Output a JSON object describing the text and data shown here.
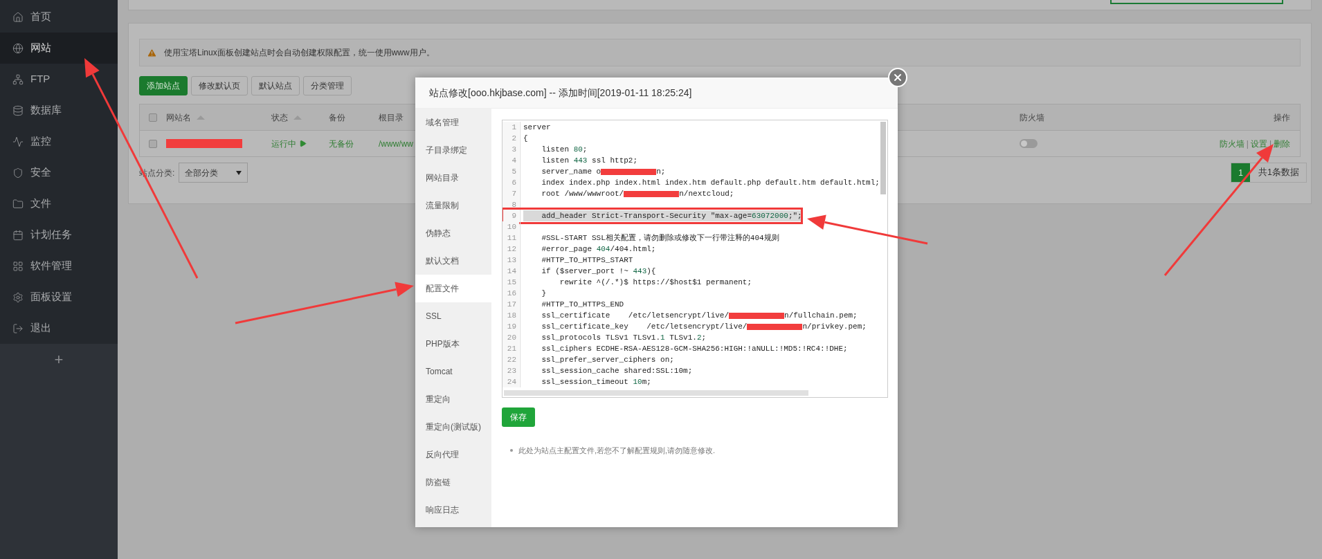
{
  "sidebar": {
    "items": [
      {
        "label": "首页",
        "selected": false
      },
      {
        "label": "网站",
        "selected": true
      },
      {
        "label": "FTP",
        "selected": false
      },
      {
        "label": "数据库",
        "selected": false
      },
      {
        "label": "监控",
        "selected": false
      },
      {
        "label": "安全",
        "selected": false
      },
      {
        "label": "文件",
        "selected": false
      },
      {
        "label": "计划任务",
        "selected": false
      },
      {
        "label": "软件管理",
        "selected": false
      },
      {
        "label": "面板设置",
        "selected": false
      },
      {
        "label": "退出",
        "selected": false
      }
    ],
    "add": "+"
  },
  "notice": "使用宝塔Linux面板创建站点时会自动创建权限配置，统一使用www用户。",
  "toolbar": [
    {
      "label": "添加站点",
      "kind": "primary"
    },
    {
      "label": "修改默认页",
      "kind": "default"
    },
    {
      "label": "默认站点",
      "kind": "default"
    },
    {
      "label": "分类管理",
      "kind": "default"
    }
  ],
  "table": {
    "all_checked": false,
    "columns": [
      {
        "label": "网站名",
        "sortable": true
      },
      {
        "label": "状态",
        "sortable": true
      },
      {
        "label": "备份",
        "sortable": false
      },
      {
        "label": "根目录",
        "sortable": false
      },
      {
        "label": "防火墙",
        "sortable": false
      },
      {
        "label": "操作",
        "sortable": false
      }
    ],
    "rows": [
      {
        "checked": false,
        "name_redacted": true,
        "status": "运行中",
        "backup": "无备份",
        "root": "/www/ww",
        "firewall_on": false,
        "actions": [
          "防火墙",
          "设置",
          "删除"
        ],
        "separator": "|"
      }
    ]
  },
  "category": {
    "label": "站点分类:",
    "value": "全部分类"
  },
  "pagination": {
    "pages": [
      {
        "label": "1",
        "selected": true
      }
    ],
    "total": "共1条数据"
  },
  "modal": {
    "title": "站点修改[ooo.hkjbase.com] -- 添加时间[2019-01-11 18:25:24]",
    "menu": [
      {
        "label": "域名管理",
        "selected": false
      },
      {
        "label": "子目录绑定",
        "selected": false
      },
      {
        "label": "网站目录",
        "selected": false
      },
      {
        "label": "流量限制",
        "selected": false
      },
      {
        "label": "伪静态",
        "selected": false
      },
      {
        "label": "默认文档",
        "selected": false
      },
      {
        "label": "配置文件",
        "selected": true
      },
      {
        "label": "SSL",
        "selected": false
      },
      {
        "label": "PHP版本",
        "selected": false
      },
      {
        "label": "Tomcat",
        "selected": false
      },
      {
        "label": "重定向",
        "selected": false
      },
      {
        "label": "重定向(测试版)",
        "selected": false
      },
      {
        "label": "反向代理",
        "selected": false
      },
      {
        "label": "防盗链",
        "selected": false
      },
      {
        "label": "响应日志",
        "selected": false
      }
    ],
    "code": [
      {
        "number": "1",
        "selected": false,
        "segments": [
          {
            "kind": "text",
            "text": "server"
          }
        ]
      },
      {
        "number": "2",
        "selected": false,
        "segments": [
          {
            "kind": "text",
            "text": "{"
          }
        ]
      },
      {
        "number": "3",
        "selected": false,
        "segments": [
          {
            "kind": "text",
            "text": "    listen "
          },
          {
            "kind": "num",
            "text": "80"
          },
          {
            "kind": "text",
            "text": ";"
          }
        ]
      },
      {
        "number": "4",
        "selected": false,
        "segments": [
          {
            "kind": "text",
            "text": "    listen "
          },
          {
            "kind": "num",
            "text": "443"
          },
          {
            "kind": "text",
            "text": " ssl http2;"
          }
        ]
      },
      {
        "number": "5",
        "selected": false,
        "segments": [
          {
            "kind": "text",
            "text": "    server_name o"
          },
          {
            "kind": "redacted"
          },
          {
            "kind": "text",
            "text": "n;"
          }
        ]
      },
      {
        "number": "6",
        "selected": false,
        "segments": [
          {
            "kind": "text",
            "text": "    index index.php index.html index.htm default.php default.htm default.html;"
          }
        ]
      },
      {
        "number": "7",
        "selected": false,
        "segments": [
          {
            "kind": "text",
            "text": "    root /www/wwwroot/"
          },
          {
            "kind": "redacted"
          },
          {
            "kind": "text",
            "text": "n/nextcloud;"
          }
        ]
      },
      {
        "number": "8",
        "selected": false
      },
      {
        "number": "9",
        "selected": true,
        "segments": [
          {
            "kind": "text",
            "text": "    add_header Strict-Transport-Security \"max-age="
          },
          {
            "kind": "num",
            "text": "63072000"
          },
          {
            "kind": "text",
            "text": ";\";"
          }
        ]
      },
      {
        "number": "10",
        "selected": false
      },
      {
        "number": "11",
        "selected": false,
        "segments": [
          {
            "kind": "text",
            "text": "    #SSL-START SSL相关配置，请勿删除或修改下一行带注释的404规则"
          }
        ]
      },
      {
        "number": "12",
        "selected": false,
        "segments": [
          {
            "kind": "text",
            "text": "    #error_page "
          },
          {
            "kind": "num",
            "text": "404"
          },
          {
            "kind": "text",
            "text": "/404.html;"
          }
        ]
      },
      {
        "number": "13",
        "selected": false,
        "segments": [
          {
            "kind": "text",
            "text": "    #HTTP_TO_HTTPS_START"
          }
        ]
      },
      {
        "number": "14",
        "selected": false,
        "segments": [
          {
            "kind": "text",
            "text": "    if ($server_port !~ "
          },
          {
            "kind": "num",
            "text": "443"
          },
          {
            "kind": "text",
            "text": "){"
          }
        ]
      },
      {
        "number": "15",
        "selected": false,
        "segments": [
          {
            "kind": "text",
            "text": "        rewrite ^(/.*)$ https://$host$1 permanent;"
          }
        ]
      },
      {
        "number": "16",
        "selected": false,
        "segments": [
          {
            "kind": "text",
            "text": "    }"
          }
        ]
      },
      {
        "number": "17",
        "selected": false,
        "segments": [
          {
            "kind": "text",
            "text": "    #HTTP_TO_HTTPS_END"
          }
        ]
      },
      {
        "number": "18",
        "selected": false,
        "segments": [
          {
            "kind": "text",
            "text": "    ssl_certificate    /etc/letsencrypt/live/"
          },
          {
            "kind": "redacted"
          },
          {
            "kind": "text",
            "text": "n/fullchain.pem;"
          }
        ]
      },
      {
        "number": "19",
        "selected": false,
        "segments": [
          {
            "kind": "text",
            "text": "    ssl_certificate_key    /etc/letsencrypt/live/"
          },
          {
            "kind": "redacted"
          },
          {
            "kind": "text",
            "text": "n/privkey.pem;"
          }
        ]
      },
      {
        "number": "20",
        "selected": false,
        "segments": [
          {
            "kind": "text",
            "text": "    ssl_protocols TLSv1 TLSv1."
          },
          {
            "kind": "num",
            "text": "1"
          },
          {
            "kind": "text",
            "text": " TLSv1."
          },
          {
            "kind": "num",
            "text": "2"
          },
          {
            "kind": "text",
            "text": ";"
          }
        ]
      },
      {
        "number": "21",
        "selected": false,
        "segments": [
          {
            "kind": "text",
            "text": "    ssl_ciphers ECDHE-RSA-AES128-GCM-SHA256:HIGH:!aNULL:!MD5:!RC4:!DHE;"
          }
        ]
      },
      {
        "number": "22",
        "selected": false,
        "segments": [
          {
            "kind": "text",
            "text": "    ssl_prefer_server_ciphers on;"
          }
        ]
      },
      {
        "number": "23",
        "selected": false,
        "segments": [
          {
            "kind": "text",
            "text": "    ssl_session_cache shared:SSL:10m;"
          }
        ]
      },
      {
        "number": "24",
        "selected": false,
        "segments": [
          {
            "kind": "text",
            "text": "    ssl_session_timeout "
          },
          {
            "kind": "num",
            "text": "10"
          },
          {
            "kind": "text",
            "text": "m;"
          }
        ]
      }
    ],
    "save": "保存",
    "note": "此处为站点主配置文件,若您不了解配置规则,请勿随意修改."
  }
}
